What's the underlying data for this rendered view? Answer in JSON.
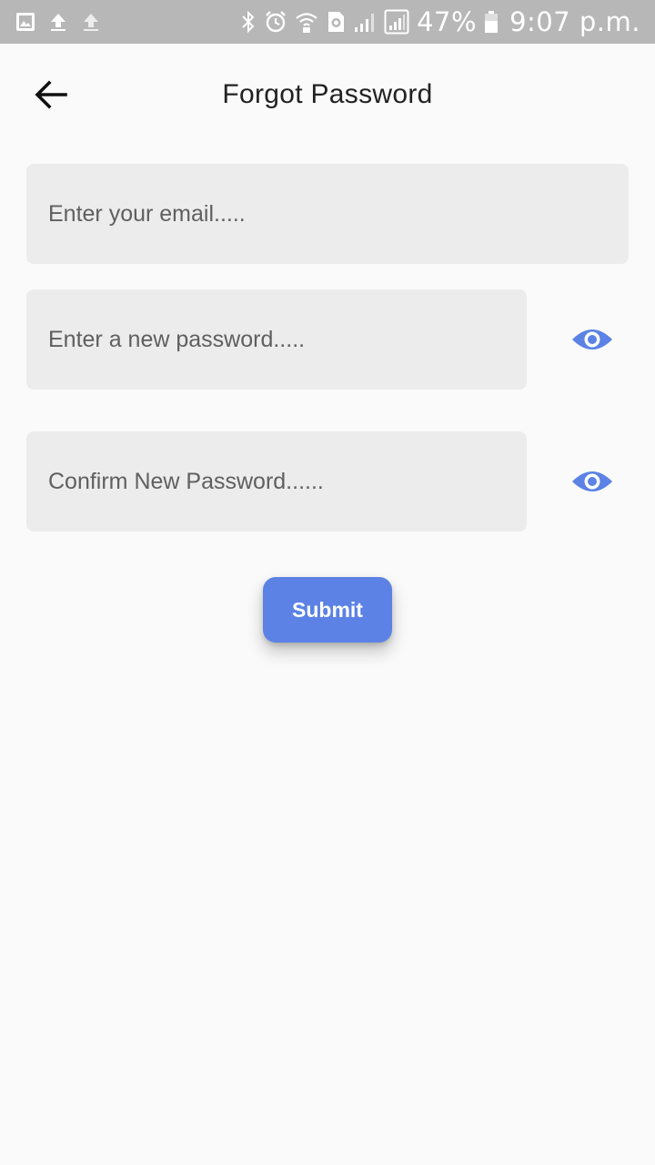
{
  "status_bar": {
    "battery_percent": "47%",
    "time": "9:07 p.m.",
    "left_icons": [
      "image-icon",
      "upload-icon",
      "upload-icon"
    ],
    "right_icons": [
      "bluetooth-icon",
      "alarm-icon",
      "wifi-icon",
      "sim-icon",
      "signal-icon",
      "signal-icon",
      "battery-icon"
    ]
  },
  "app_bar": {
    "back_icon": "arrow-left-icon",
    "title": "Forgot Password"
  },
  "form": {
    "email": {
      "placeholder": "Enter your email.....",
      "value": ""
    },
    "new_password": {
      "placeholder": "Enter a new password.....",
      "value": "",
      "toggle_icon": "eye-icon"
    },
    "confirm_password": {
      "placeholder": "Confirm New Password......",
      "value": "",
      "toggle_icon": "eye-icon"
    },
    "submit_label": "Submit"
  },
  "colors": {
    "accent": "#5b82e4",
    "status_bar": "#b7b7b7",
    "field_background": "#ececec",
    "page_background": "#fafafa"
  }
}
